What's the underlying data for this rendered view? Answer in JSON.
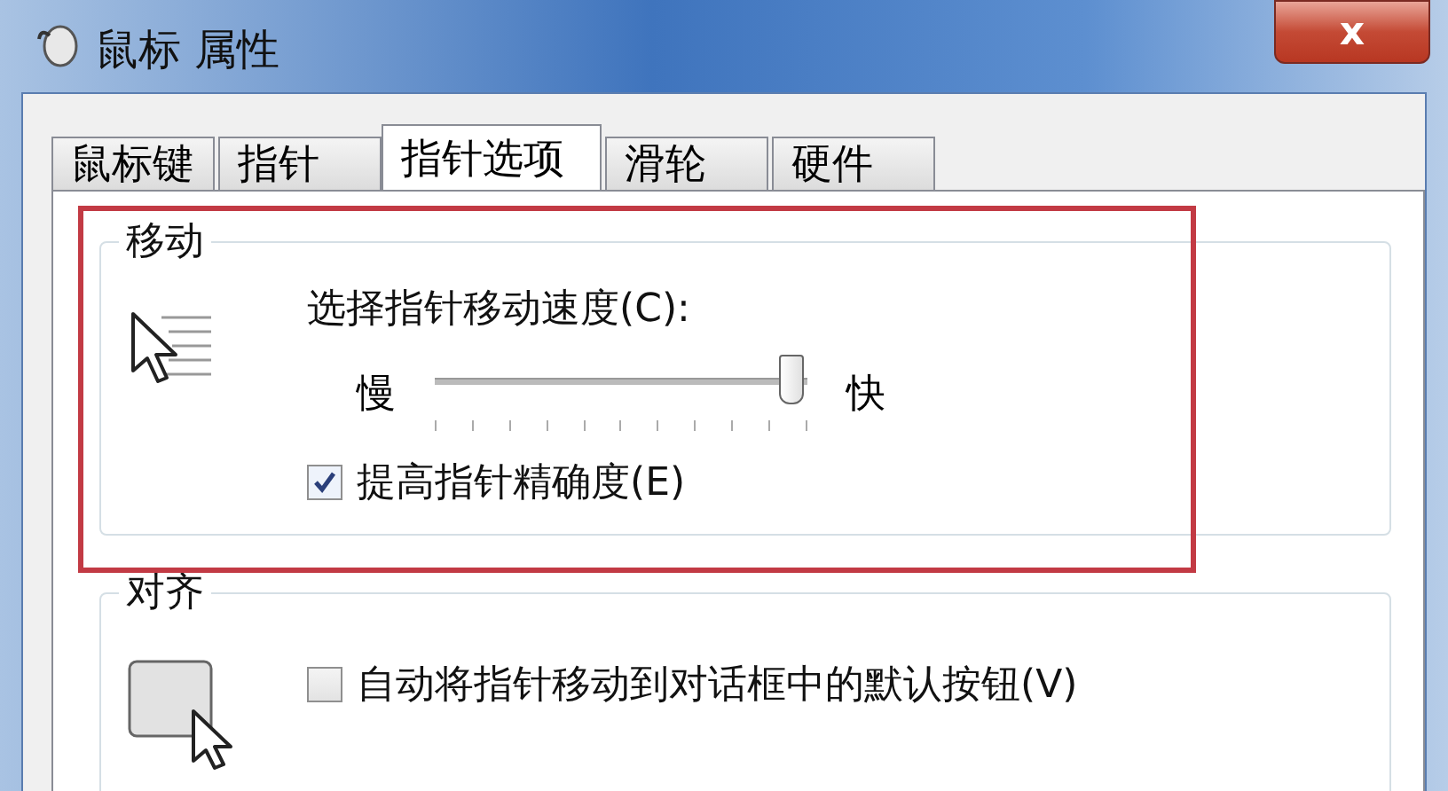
{
  "window": {
    "title": "鼠标 属性",
    "close": "x"
  },
  "tabs": [
    {
      "label": "鼠标键",
      "selected": false
    },
    {
      "label": "指针",
      "selected": false
    },
    {
      "label": "指针选项",
      "selected": true
    },
    {
      "label": "滑轮",
      "selected": false
    },
    {
      "label": "硬件",
      "selected": false
    }
  ],
  "annotation": {
    "kind": "highlight-box"
  },
  "groups": [
    {
      "title": "移动",
      "items": [
        {
          "kind": "label",
          "text": "选择指针移动速度(C):"
        },
        {
          "kind": "slider",
          "min_label": "慢",
          "max_label": "快",
          "level": 0.98
        },
        {
          "kind": "checkbox",
          "label": "提高指针精确度(E)",
          "checked": true
        }
      ]
    },
    {
      "title": "对齐",
      "items": [
        {
          "kind": "checkbox",
          "label": "自动将指针移动到对话框中的默认按钮(V)",
          "checked": false
        }
      ]
    }
  ]
}
